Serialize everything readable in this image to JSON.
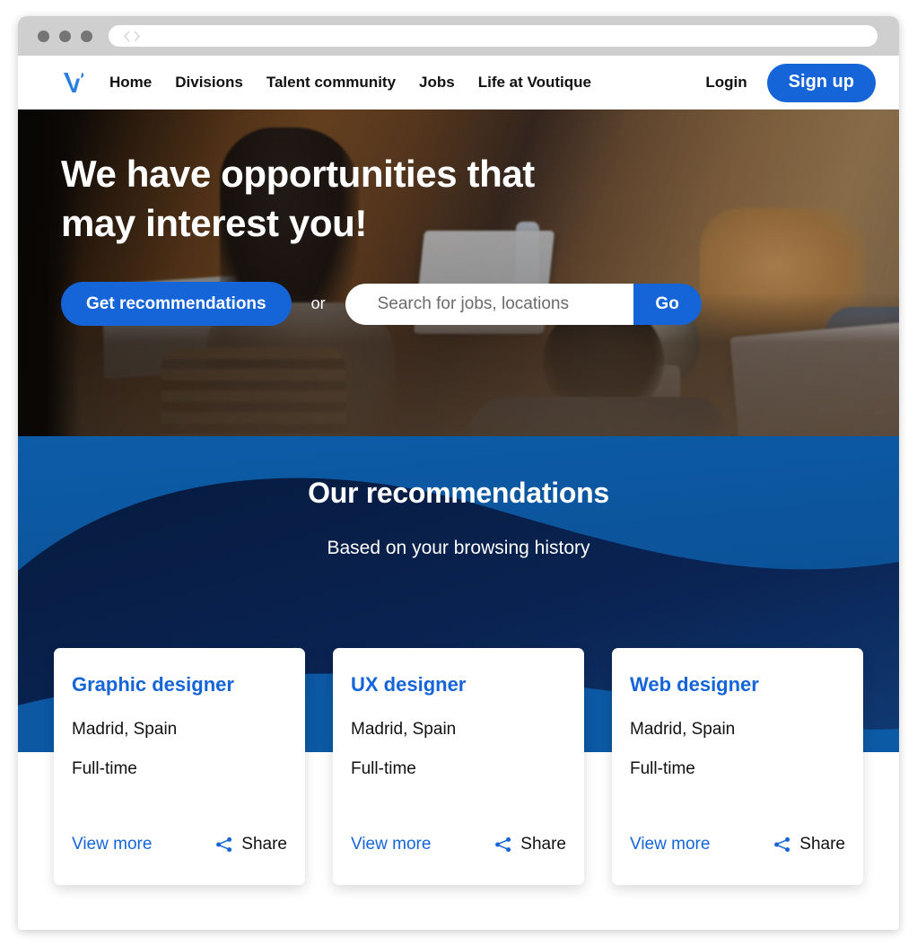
{
  "browser": {
    "url_value": "",
    "back_icon": "chevron-left-icon",
    "forward_icon": "chevron-right-icon"
  },
  "nav": {
    "logo_alt": "Voutique logo",
    "links": [
      {
        "label": "Home"
      },
      {
        "label": "Divisions"
      },
      {
        "label": "Talent community"
      },
      {
        "label": "Jobs"
      },
      {
        "label": "Life at Voutique"
      }
    ],
    "login_label": "Login",
    "signup_label": "Sign up"
  },
  "hero": {
    "title_line1": "We have opportunities that",
    "title_line2": "may interest you!",
    "cta_label": "Get recommendations",
    "or_label": "or",
    "search_placeholder": "Search for jobs, locations",
    "search_value": "",
    "go_label": "Go"
  },
  "recommendations": {
    "title": "Our recommendations",
    "subtitle": "Based on your browsing history",
    "cards": [
      {
        "title": "Graphic designer",
        "location": "Madrid, Spain",
        "employment_type": "Full-time",
        "view_more_label": "View more",
        "share_label": "Share"
      },
      {
        "title": "UX designer",
        "location": "Madrid, Spain",
        "employment_type": "Full-time",
        "view_more_label": "View more",
        "share_label": "Share"
      },
      {
        "title": "Web designer",
        "location": "Madrid, Spain",
        "employment_type": "Full-time",
        "view_more_label": "View more",
        "share_label": "Share"
      }
    ]
  },
  "colors": {
    "brand_blue": "#1565d8",
    "section_blue": "#0a5096",
    "section_navy": "#0a2352",
    "page_bg": "#f7f7f7",
    "titlebar": "#cfcfcf"
  }
}
